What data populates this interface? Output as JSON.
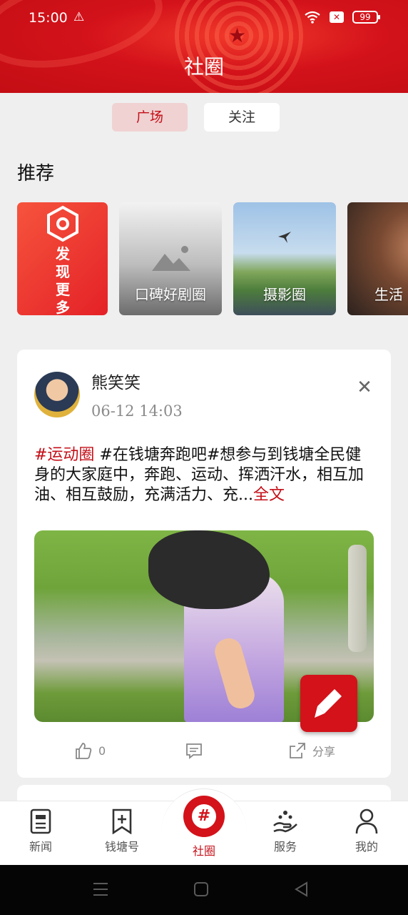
{
  "status_bar": {
    "time": "15:00",
    "battery": "99"
  },
  "header": {
    "title": "社圈"
  },
  "tabs": [
    {
      "label": "广场",
      "active": true
    },
    {
      "label": "关注",
      "active": false
    }
  ],
  "recommend": {
    "title": "推荐",
    "tiles": [
      {
        "label": "发现更多",
        "icon": "hexagon-icon"
      },
      {
        "label": "口碑好剧圈",
        "icon": "image-placeholder-icon"
      },
      {
        "label": "摄影圈"
      },
      {
        "label": "生活"
      }
    ]
  },
  "post": {
    "author": "熊笑笑",
    "time": "06-12  14:03",
    "hashtag": "#运动圈",
    "text": " #在钱塘奔跑吧#想参与到钱塘全民健身的大家庭中，奔跑、运动、挥洒汗水，相互加油、相互鼓励，充满活力、充...",
    "more": "全文",
    "likes": "0",
    "share": "分享"
  },
  "bottom_nav": [
    {
      "label": "新闻"
    },
    {
      "label": "钱塘号"
    },
    {
      "label": "社圈",
      "active": true
    },
    {
      "label": "服务"
    },
    {
      "label": "我的"
    }
  ],
  "colors": {
    "accent": "#d3121a",
    "background": "#efefef"
  }
}
